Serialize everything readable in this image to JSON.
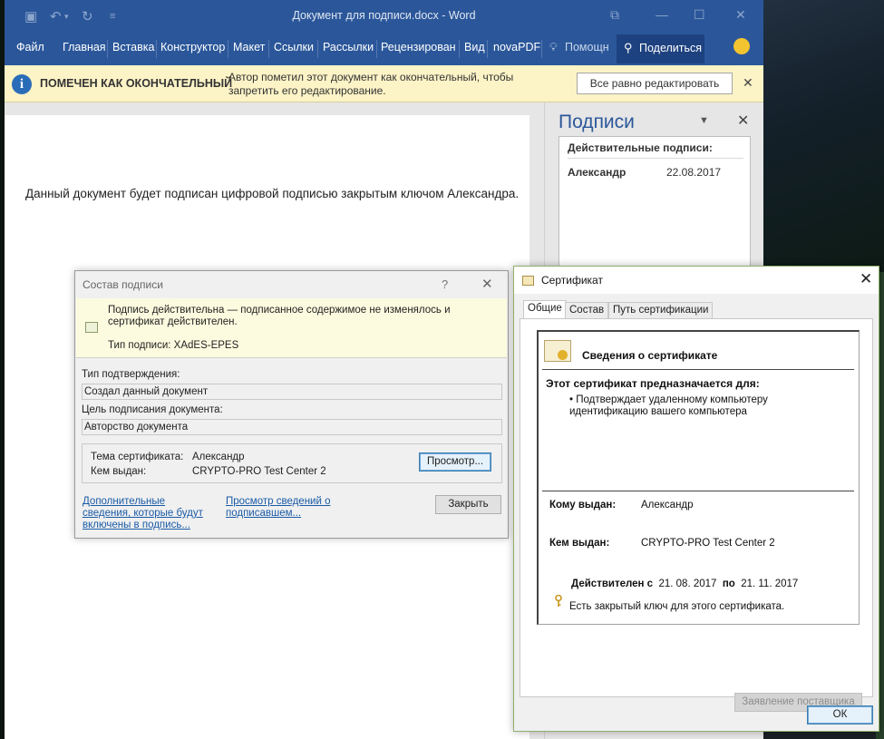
{
  "word": {
    "window_title": "Документ для подписи.docx  -  Word",
    "ribbon_tabs": [
      "Файл",
      "Главная",
      "Вставка",
      "Конструктор",
      "Макет",
      "Ссылки",
      "Рассылки",
      "Рецензирован",
      "Вид",
      "novaPDF",
      "Помощн"
    ],
    "share_label": "Поделиться",
    "infobar": {
      "title": "ПОМЕЧЕН КАК ОКОНЧАТЕЛЬНЫЙ",
      "message": "Автор пометил этот документ как окончательный, чтобы запретить его редактирование.",
      "edit_button": "Все равно редактировать"
    },
    "document_text": "Данный документ будет подписан цифровой подписью закрытым ключом Александра.",
    "signatures_pane": {
      "title": "Подписи",
      "section_title": "Действительные подписи:",
      "signer": "Александр",
      "date": "22.08.2017"
    }
  },
  "signature_dialog": {
    "title": "Состав подписи",
    "banner_text": "Подпись действительна — подписанное содержимое не изменялось и сертификат действителен.",
    "signature_type": "Тип подписи: XAdES-EPES",
    "commitment_label": "Тип подтверждения:",
    "commitment_value": "Создал данный документ",
    "purpose_label": "Цель подписания документа:",
    "purpose_value": "Авторство документа",
    "cert_subject_label": "Тема сертификата:",
    "cert_subject_value": "Александр",
    "issued_by_label": "Кем выдан:",
    "issued_by_value": "CRYPTO-PRO Test Center 2",
    "view_button": "Просмотр...",
    "link_additional": "Дополнительные сведения, которые будут включены в подпись...",
    "link_signer": "Просмотр сведений о подписавшем...",
    "close_button": "Закрыть"
  },
  "certificate_dialog": {
    "title": "Сертификат",
    "tabs": [
      "Общие",
      "Состав",
      "Путь сертификации"
    ],
    "header": "Сведения о сертификате",
    "purpose_title": "Этот сертификат предназначается для:",
    "purpose_item": "• Подтверждает удаленному компьютеру идентификацию вашего компьютера",
    "issued_to_label": "Кому выдан:",
    "issued_to_value": "Александр",
    "issued_by_label": "Кем выдан:",
    "issued_by_value": "CRYPTO-PRO Test Center 2",
    "valid_from_label": "Действителен с",
    "valid_from": "21. 08. 2017",
    "valid_to_label": "по",
    "valid_to": "21. 11. 2017",
    "private_key_note": "Есть закрытый ключ для этого сертификата.",
    "issuer_statement_button": "Заявление поставщика",
    "ok_button": "ОК"
  }
}
